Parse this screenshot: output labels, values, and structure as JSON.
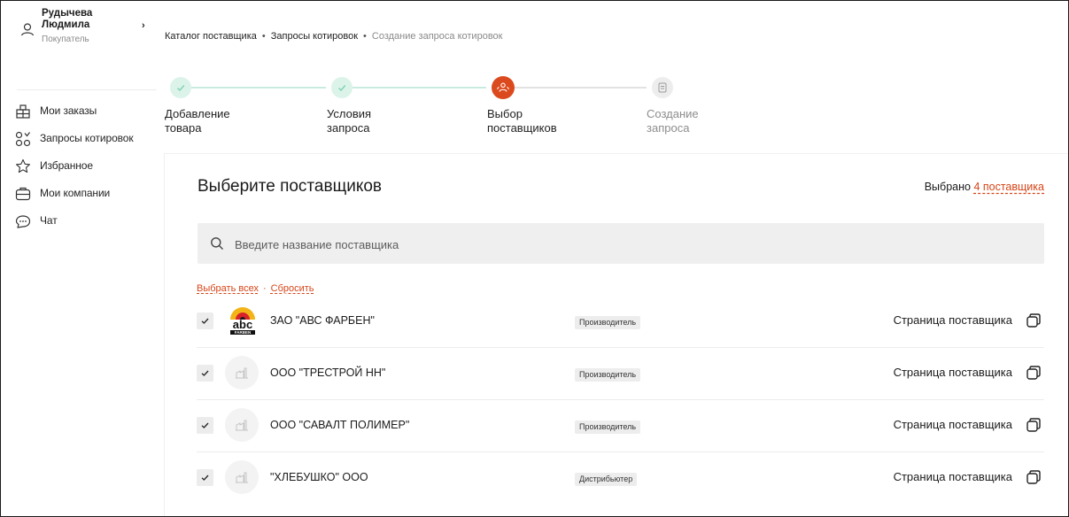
{
  "user": {
    "first_name": "Рудычева",
    "last_name": "Людмила",
    "role": "Покупатель",
    "chevron": "›"
  },
  "nav": {
    "items": [
      {
        "label": "Мои заказы",
        "icon": "building-icon"
      },
      {
        "label": "Запросы котировок",
        "icon": "quotes-icon"
      },
      {
        "label": "Избранное",
        "icon": "star-icon"
      },
      {
        "label": "Мои компании",
        "icon": "briefcase-icon"
      },
      {
        "label": "Чат",
        "icon": "chat-icon"
      }
    ]
  },
  "breadcrumbs": {
    "items": [
      "Каталог поставщика",
      "Запросы котировок",
      "Создание запроса котировок"
    ],
    "separator": "•"
  },
  "stepper": {
    "steps": [
      {
        "label": "Добавление\nтовара",
        "state": "done"
      },
      {
        "label": "Условия\nзапроса",
        "state": "done"
      },
      {
        "label": "Выбор\nпоставщиков",
        "state": "active"
      },
      {
        "label": "Создание\nзапроса",
        "state": "todo"
      }
    ]
  },
  "main": {
    "title": "Выберите поставщиков",
    "selected_prefix": "Выбрано",
    "selected_link": "4 поставщика",
    "search_placeholder": "Введите название поставщика",
    "select_all": "Выбрать всех",
    "bulk_separator": "·",
    "reset": "Сбросить"
  },
  "suppliers": [
    {
      "name": "ЗАО \"АВС ФАРБЕН\"",
      "type": "Производитель",
      "link": "Страница поставщика",
      "checked": true,
      "logo": "abc-farben-logo",
      "logo_text": "abc",
      "logo_subtext": "FARBEN"
    },
    {
      "name": "ООО \"ТРЕСТРОЙ НН\"",
      "type": "Производитель",
      "link": "Страница поставщика",
      "checked": true,
      "logo": "factory-placeholder-icon"
    },
    {
      "name": "ООО \"САВАЛТ ПОЛИМЕР\"",
      "type": "Производитель",
      "link": "Страница поставщика",
      "checked": true,
      "logo": "factory-placeholder-icon"
    },
    {
      "name": "\"ХЛЕБУШКО\" ООО",
      "type": "Дистрибьютер",
      "link": "Страница поставщика",
      "checked": true,
      "logo": "factory-placeholder-icon"
    }
  ],
  "colors": {
    "accent": "#db4a1e",
    "link": "#d64518",
    "step_done_bg": "#dcf3ea",
    "step_done_check": "#7fd2b3",
    "step_todo_bg": "#ededed"
  }
}
